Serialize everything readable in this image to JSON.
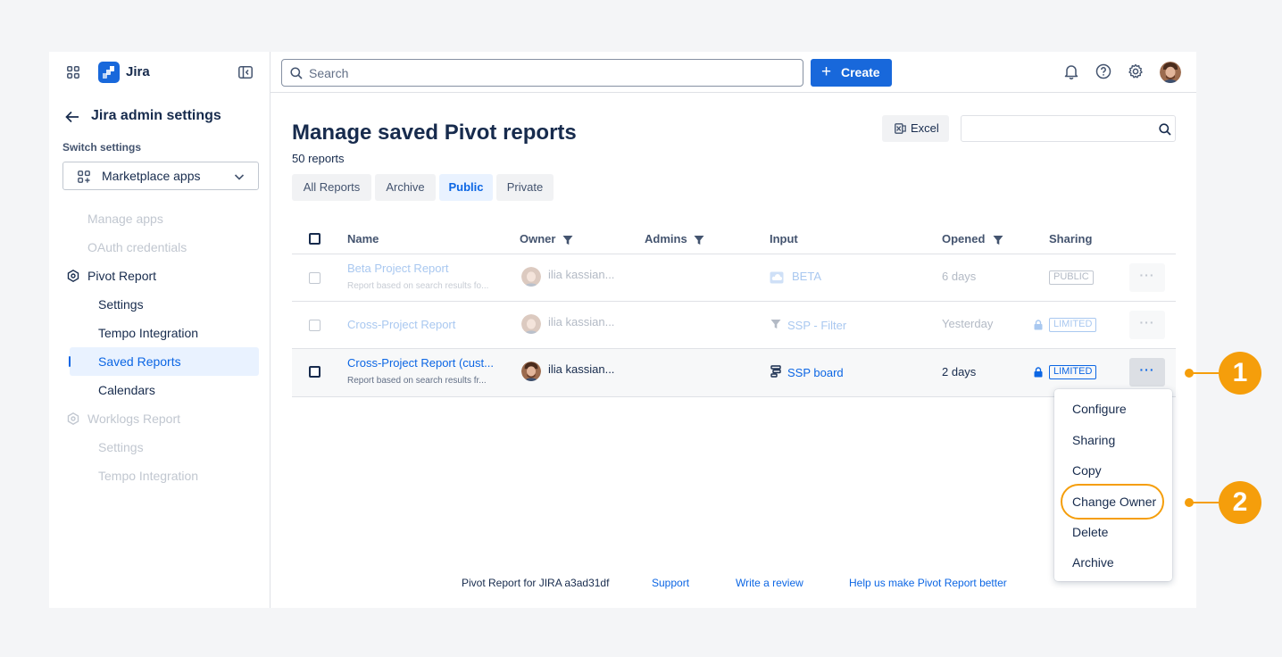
{
  "sidebar": {
    "app_name": "Jira",
    "back_title": "Jira admin settings",
    "switch_label": "Switch settings",
    "switch_value": "Marketplace apps",
    "items": [
      {
        "label": "Manage apps"
      },
      {
        "label": "OAuth credentials"
      },
      {
        "label": "Pivot Report"
      },
      {
        "label": "Settings"
      },
      {
        "label": "Tempo Integration"
      },
      {
        "label": "Saved Reports"
      },
      {
        "label": "Calendars"
      },
      {
        "label": "Worklogs Report"
      },
      {
        "label": "Settings"
      },
      {
        "label": "Tempo Integration"
      }
    ]
  },
  "topbar": {
    "search_placeholder": "Search",
    "create_label": "Create"
  },
  "main": {
    "title": "Manage saved Pivot reports",
    "count": "50 reports",
    "excel_label": "Excel",
    "tabs": [
      {
        "label": "All Reports"
      },
      {
        "label": "Archive"
      },
      {
        "label": "Public"
      },
      {
        "label": "Private"
      }
    ],
    "columns": {
      "name": "Name",
      "owner": "Owner",
      "admins": "Admins",
      "input": "Input",
      "opened": "Opened",
      "sharing": "Sharing"
    },
    "rows": [
      {
        "name": "Beta Project Report",
        "desc": "Report based on search results fo...",
        "owner": "ilia kassian...",
        "input": "BETA",
        "opened": "6 days",
        "sharing": "PUBLIC",
        "more": "···"
      },
      {
        "name": "Cross-Project Report",
        "desc": "",
        "owner": "ilia kassian...",
        "input": "SSP - Filter",
        "opened": "Yesterday",
        "sharing": "LIMITED",
        "more": "···"
      },
      {
        "name": "Cross-Project Report (cust...",
        "desc": "Report based on search results fr...",
        "owner": "ilia kassian...",
        "input": "SSP board",
        "opened": "2 days",
        "sharing": "LIMITED",
        "more": "···"
      }
    ]
  },
  "menu": {
    "items": [
      {
        "label": "Configure"
      },
      {
        "label": "Sharing"
      },
      {
        "label": "Copy"
      },
      {
        "label": "Change Owner"
      },
      {
        "label": "Delete"
      },
      {
        "label": "Archive"
      }
    ]
  },
  "footer": {
    "version": "Pivot Report for JIRA a3ad31df",
    "support": "Support",
    "review": "Write a review",
    "help": "Help us make Pivot Report better"
  },
  "callouts": {
    "one": "1",
    "two": "2"
  },
  "colors": {
    "accent": "#1868db",
    "callout": "#f59e0b",
    "active_bg": "#e9f2ff"
  }
}
